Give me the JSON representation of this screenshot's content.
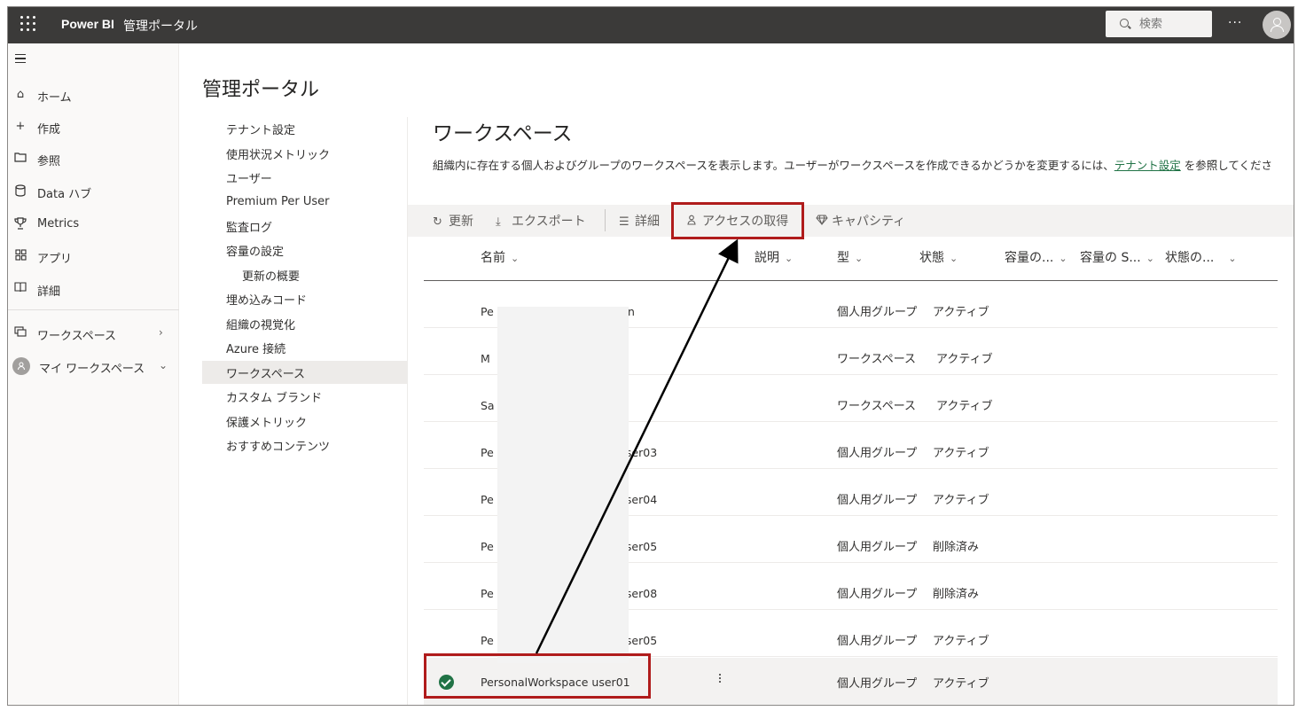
{
  "topbar": {
    "brand": "Power BI",
    "section": "管理ポータル",
    "search_placeholder": "検索",
    "more": "···"
  },
  "leftnav": {
    "items": [
      {
        "label": "ホーム",
        "icon": "home-icon"
      },
      {
        "label": "作成",
        "icon": "plus-icon"
      },
      {
        "label": "参照",
        "icon": "folder-icon"
      },
      {
        "label": "Data ハブ",
        "icon": "database-icon"
      },
      {
        "label": "Metrics",
        "icon": "trophy-icon"
      },
      {
        "label": "アプリ",
        "icon": "apps-icon"
      },
      {
        "label": "詳細",
        "icon": "book-icon"
      }
    ],
    "workspaces": "ワークスペース",
    "my_workspace": "マイ ワークスペース"
  },
  "portal": {
    "title": "管理ポータル",
    "subnav": [
      "テナント設定",
      "使用状況メトリック",
      "ユーザー",
      "Premium Per User",
      "監査ログ",
      "容量の設定",
      "更新の概要",
      "埋め込みコード",
      "組織の視覚化",
      "Azure 接続",
      "ワークスペース",
      "カスタム ブランド",
      "保護メトリック",
      "おすすめコンテンツ"
    ],
    "active_item": "ワークスペース"
  },
  "workspaces": {
    "title": "ワークスペース",
    "desc_prefix": "組織内に存在する個人およびグループのワークスペースを表示します。ユーザーがワークスペースを作成できるかどうかを変更するには、",
    "desc_link": "テナント設定",
    "desc_suffix": " を参照してくださ",
    "toolbar": {
      "refresh": "更新",
      "export": "エクスポート",
      "details": "詳細",
      "get_access": "アクセスの取得",
      "capacity": "キャパシティ"
    },
    "columns": [
      "名前",
      "説明",
      "型",
      "状態",
      "容量の...",
      "容量の S...",
      "状態の..."
    ],
    "rows": [
      {
        "name_start": "Pe",
        "name_end": "n",
        "type": "個人用グループ",
        "state": "アクティブ"
      },
      {
        "name_start": "M",
        "name_end": "",
        "type": "ワークスペース",
        "state": "アクティブ"
      },
      {
        "name_start": "Sa",
        "name_end": "",
        "type": "ワークスペース",
        "state": "アクティブ"
      },
      {
        "name_start": "Pe",
        "name_end": "user03",
        "type": "個人用グループ",
        "state": "アクティブ"
      },
      {
        "name_start": "Pe",
        "name_end": "user04",
        "type": "個人用グループ",
        "state": "アクティブ"
      },
      {
        "name_start": "Pe",
        "name_end": "user05",
        "type": "個人用グループ",
        "state": "削除済み"
      },
      {
        "name_start": "Pe",
        "name_end": "user08",
        "type": "個人用グループ",
        "state": "削除済み"
      },
      {
        "name_start": "Pe",
        "name_end": "user05",
        "type": "個人用グループ",
        "state": "アクティブ"
      }
    ],
    "selected_row": {
      "name": "PersonalWorkspace user01",
      "type": "個人用グループ",
      "state": "アクティブ"
    }
  },
  "colors": {
    "topbar": "#3b3a39",
    "accent": "#217346",
    "annotation": "#b01c1c"
  }
}
